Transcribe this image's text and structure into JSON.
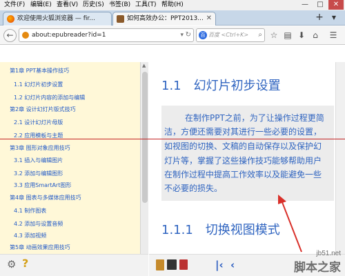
{
  "menubar": {
    "items": [
      "文件(F)",
      "编辑(E)",
      "查看(V)",
      "历史(S)",
      "书签(B)",
      "工具(T)",
      "帮助(H)"
    ],
    "window_controls": [
      "—",
      "□",
      "✕"
    ]
  },
  "tabs": [
    {
      "label": "欢迎使用火狐浏览器 — fir...",
      "active": false,
      "icon": "firefox-icon"
    },
    {
      "label": "如何高效办公：PPT2013...",
      "active": true,
      "icon": "book-icon"
    }
  ],
  "navbar": {
    "url": "about:epubreader?id=1",
    "search_placeholder": "百度 <Ctrl+K>",
    "icons": [
      "back-icon",
      "reload-icon",
      "search-icon",
      "star-icon",
      "bookmarks-icon",
      "download-icon",
      "home-icon",
      "menu-icon"
    ]
  },
  "toc": [
    {
      "label": "第1章 PPT基本操作技巧",
      "level": 1
    },
    {
      "label": "1.1 幻灯片初步设置",
      "level": 2
    },
    {
      "label": "1.2 幻灯片内容的添加与编辑",
      "level": 2
    },
    {
      "label": "第2章 设计幻灯片版式技巧",
      "level": 1
    },
    {
      "label": "2.1 设计幻灯片母版",
      "level": 2
    },
    {
      "label": "2.2 应用模板与主题",
      "level": 2
    },
    {
      "label": "第3章 图形对象应用技巧",
      "level": 1
    },
    {
      "label": "3.1 插入与编辑图片",
      "level": 2
    },
    {
      "label": "3.2 添加与编辑图形",
      "level": 2
    },
    {
      "label": "3.3 应用SmartArt图形",
      "level": 2
    },
    {
      "label": "第4章 图表与多媒体应用技巧",
      "level": 1
    },
    {
      "label": "4.1 制作图表",
      "level": 2
    },
    {
      "label": "4.2 添加与设置音频",
      "level": 2
    },
    {
      "label": "4.3 添加视频",
      "level": 2
    },
    {
      "label": "第5章 动画效果应用技巧",
      "level": 1
    }
  ],
  "content": {
    "heading1": "1.1　幻灯片初步设置",
    "paragraph_lines": [
      "在制作PPT之前，为了让操作过程更简",
      "洁，方便还需要对其进行一些必要的设置，",
      "如视图的切换、文稿的自动保存以及保护幻",
      "灯片等，掌握了这些操作技巧能够帮助用户",
      "在制作过程中提高工作效率以及能避免一些",
      "不必要的损失。"
    ],
    "heading2": "1.1.1　切换视图模式"
  },
  "watermark": {
    "site": "jb51.net",
    "name": "脚本之家"
  },
  "colors": {
    "link": "#1f58c7",
    "heading": "#2f64c0",
    "sidebar_bg": "#fff8d8",
    "annotation": "#d9302a"
  }
}
